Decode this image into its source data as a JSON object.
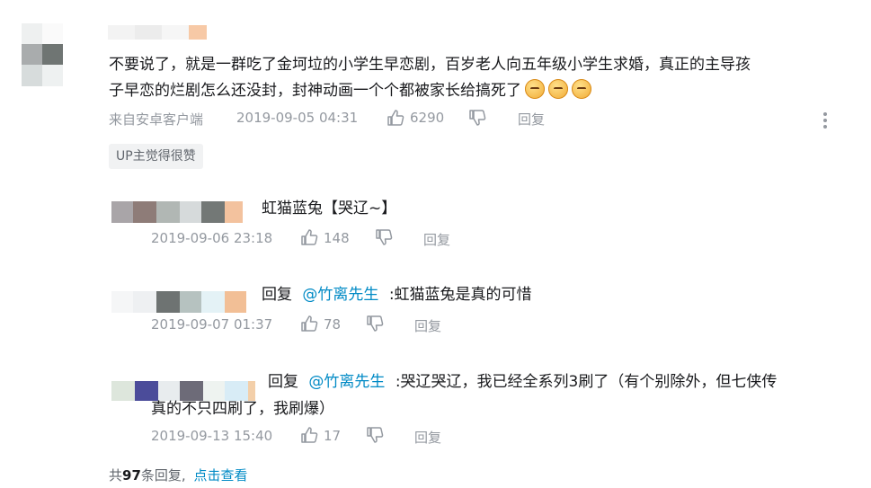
{
  "main_comment": {
    "text_line1": "不要说了，就是一群吃了金坷垃的小学生早恋剧，百岁老人向五年级小学生求婚，真正的主导孩",
    "text_line2": "子早恋的烂剧怎么还没封，封神动画一个个都被家长给搞死了",
    "emojis": [
      "emoji-sweat",
      "emoji-grin",
      "emoji-grin"
    ],
    "source": "来自安卓客户端",
    "time": "2019-09-05 04:31",
    "likes": "6290",
    "reply_label": "回复",
    "up_badge": "UP主觉得很赞"
  },
  "replies": [
    {
      "prefix": "",
      "mention": "",
      "text": "虹猫蓝兔【哭辽~】",
      "text_line2": "",
      "time": "2019-09-06 23:18",
      "likes": "148",
      "reply_label": "回复"
    },
    {
      "prefix": "回复",
      "mention": "@竹离先生",
      "text": ":虹猫蓝兔是真的可惜",
      "text_line2": "",
      "time": "2019-09-07 01:37",
      "likes": "78",
      "reply_label": "回复"
    },
    {
      "prefix": "回复",
      "mention": "@竹离先生",
      "text": ":哭辽哭辽，我已经全系列3刷了（有个别除外，但七侠传",
      "text_line2": "真的不只四刷了，我刷爆）",
      "time": "2019-09-13 15:40",
      "likes": "17",
      "reply_label": "回复"
    }
  ],
  "footer": {
    "count_prefix": "共",
    "count": "97",
    "count_suffix": "条回复,",
    "view_link": "点击查看"
  },
  "colors": {
    "link": "#008ac5",
    "meta": "#9499a0",
    "text": "#18191c",
    "badge_bg": "#f1f2f3"
  }
}
